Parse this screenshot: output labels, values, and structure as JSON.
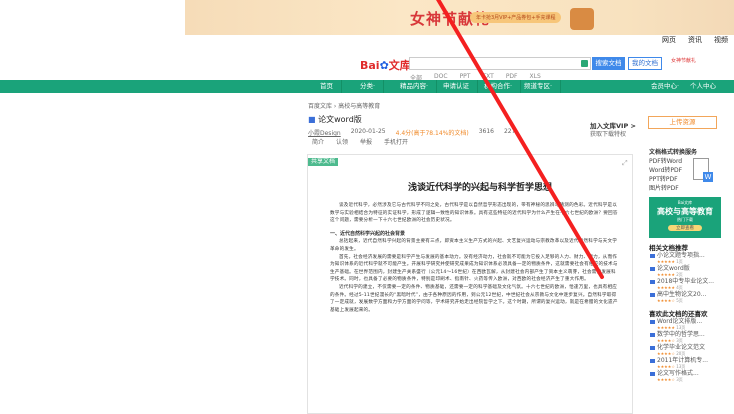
{
  "banner": {
    "title": "女神节献礼",
    "promo": "年卡抢3月VIP+产品券包+手充课程"
  },
  "toplinks": [
    "网页",
    "资讯",
    "视频"
  ],
  "header": {
    "logo_text": "Bai",
    "logo_suffix": "文库",
    "search_placeholder": "",
    "search_button": "搜索文档",
    "my_docs_button": "我的文档",
    "promo": "女神节献礼"
  },
  "filters": [
    "全部",
    "DOC",
    "PPT",
    "TXT",
    "PDF",
    "XLS"
  ],
  "nav": {
    "items": [
      "首页",
      "分类·",
      "精品内容·",
      "申请认证",
      "机构合作·",
      "频道专区·"
    ],
    "right": [
      "会员中心·",
      "个人中心"
    ]
  },
  "doc": {
    "breadcrumb": "百度文库 › 高校与高等教育",
    "title": "论文word版",
    "author": "小霞Design",
    "date": "2020-01-25",
    "rating": "4.4分(高于78.14%的文档)",
    "views": "3616",
    "downloads": "227",
    "actions": [
      "简介",
      "认领",
      "举报",
      "手机打开"
    ],
    "share_label": "共享文档"
  },
  "vip": {
    "title": "加入文库VIP >",
    "subtitle": "获取下载特权",
    "upload": "上传资源"
  },
  "page": {
    "heading": "浅谈近代科学的兴起与科学哲学思想",
    "para1": "谈及近代科学，必然涉及它与古代科学不同之处，古代科学是以自然哲学形态出现的，带有神秘的思辨与猜测的色彩。近代科学是以数学与实验相结合为特征的实证科学，形成了逻辑一致性的知识体系。具有这些特征的近代科学为什么产生在十六七世纪的欧洲？要回答这个问题，需要分析一下十六七世纪欧洲的社会历史状况。",
    "section1": "一、近代自然科学兴起的社会背景",
    "para2": "总括起来，近代自然科学兴起的背景主要有三点，即资本主义生产方式的兴起、文艺复兴运动与宗教改革以及近代自然科学与天文学革命的发生。",
    "para3": "首先，社会经济发展的需要是科学产生与发展的基本动力。没有经济动力，社会就不可能为它投入足够的人力、财力、物力，从而作为知识体系的近代科学就不可能产生。开展科学研究并使研究成果成为知识体系必须具备一定的物质条件，这就需要社会有相应的技术与生产基础。在世界范围内，封建生产关系盛行（公元14～16世纪）在西欧瓦解，从封建社会内部产生了资本主义萌芽，社会需要发展科学技术。同时，也具备了必要的物质条件，特别是印刷术、指南针、火药等传入欧洲，对西欧的社会经济产生了重大作用。",
    "para4": "近代科学的建立，不仅需要一定的条件、物质基础，还需要一定的科学基础及文化气氛。十六七世纪的欧洲，恰逢万里，也具有相应的条件。经过5-11世纪漫长的“黑暗时代”，由于各种原因的作用，到公元12世纪，中世纪社会从宗教与文化中逐步复兴。自然科学取得了一定成就，发展数学方面和力学方面的学问等，学术研究开始走出经院哲学之下。这个时期，所谓的复兴运动，就是在希腊的文化遗产基础上发展起来的。"
  },
  "sidebar": {
    "tools_title": "文档格式转换服务",
    "tools": [
      "PDF转Word",
      "Word转PDF",
      "PPT转PDF",
      "图片转PDF"
    ],
    "edu": {
      "brand": "Bai文库",
      "title": "高校与高等教育",
      "sub": "热门下载",
      "button": "立即查看"
    },
    "related_title": "相关文档推荐",
    "related": [
      {
        "title": "小论文题专项指...",
        "meta": "1页"
      },
      {
        "title": "论文word版",
        "meta": "2页"
      },
      {
        "title": "2018中专毕业论文...",
        "meta": "4页"
      },
      {
        "title": "高中生物论文20...",
        "meta": "5页"
      }
    ],
    "liked_title": "喜欢此文档的还喜欢",
    "liked": [
      {
        "title": "Word论文排版...",
        "meta": "13页"
      },
      {
        "title": "数学中的哲学思...",
        "meta": "3页"
      },
      {
        "title": "化学毕业论文范文",
        "meta": "20页"
      },
      {
        "title": "2011年计算机专...",
        "meta": "13页"
      },
      {
        "title": "论文写作格式...",
        "meta": "3页"
      }
    ]
  },
  "colors": {
    "green": "#1aa37a",
    "blue": "#3f89ea",
    "orange": "#f08a2a",
    "slash": "#f42020"
  }
}
